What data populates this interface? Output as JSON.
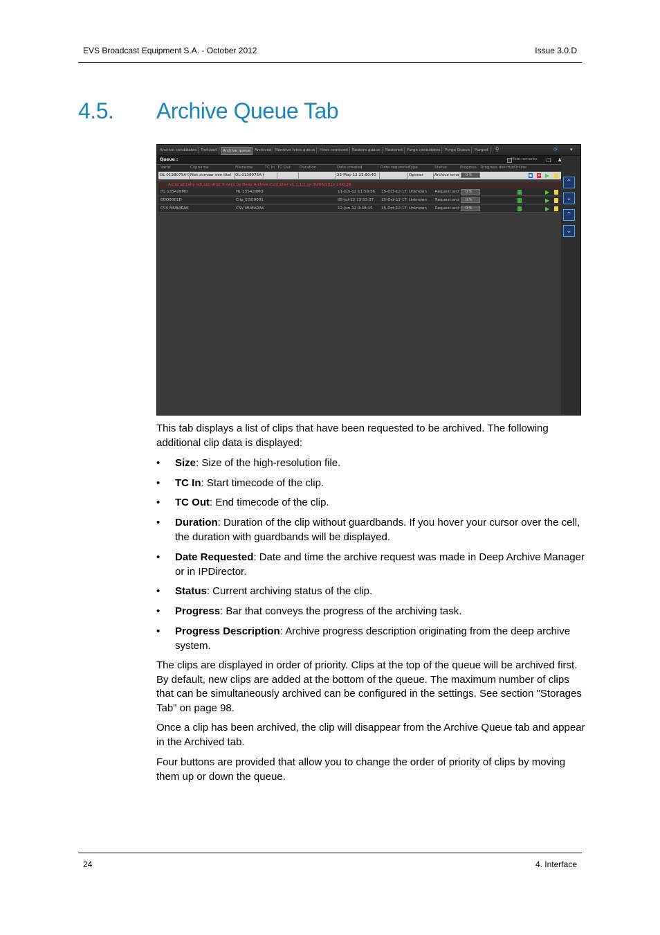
{
  "header": {
    "left": "EVS Broadcast Equipment S.A.  - October 2012",
    "right": "Issue 3.0.D"
  },
  "footer": {
    "left": "24",
    "right": "4. Interface"
  },
  "section": {
    "number": "4.5.",
    "title": "Archive Queue Tab"
  },
  "screenshot": {
    "tabs": [
      "Archive candidates",
      "Refused",
      "Archive queue",
      "Archived",
      "Remove hires queue",
      "Hires removed",
      "Restore queue",
      "Restored",
      "Purge candidates",
      "Purge Queue",
      "Purged"
    ],
    "active_tab": "Archive queue",
    "queue_label": "Queue :",
    "hide_remarks": "Hide remarks",
    "columns": [
      "VarId",
      "Clipname",
      "Filename",
      "TC In",
      "TC Out",
      "Duration",
      "Date created",
      "Date requested",
      "Type",
      "Status",
      "Progress",
      "Progress descript",
      "Online"
    ],
    "rows": [
      {
        "varid": "OL 0138075A 0",
        "clipname": "Niet zomaar een titel",
        "filename": "OL 0138075A 0",
        "date_created": "25-May-12 23:50:40",
        "date_requested": "",
        "type": "Opener",
        "status": "Archive error",
        "progress": "0 %"
      },
      {
        "varid": "HL 135428MO",
        "clipname": "",
        "filename": "HL 135428MO",
        "date_created": "11-Jun-12 11:59:56",
        "date_requested": "15-Oct-12 17:",
        "type": "Unknown",
        "status": "Request arch",
        "progress": "0 %"
      },
      {
        "varid": "EGO0001D",
        "clipname": "",
        "filename": "Clip_EGO0001D",
        "date_created": "05-Jul-12 13:53:37",
        "date_requested": "15-Oct-12 17:",
        "type": "Unknown",
        "status": "Request arch",
        "progress": "0 %"
      },
      {
        "varid": "CSV MUBARAK",
        "clipname": "",
        "filename": "CSV MUBARAK",
        "date_created": "12-Jun-12 0:48:15",
        "date_requested": "15-Oct-12 17:",
        "type": "Unknown",
        "status": "Request arch",
        "progress": "0 %"
      }
    ],
    "remark": "Automatically refused after 5 days by Deep Archive Controller v1.1.1.1 on 30/05/2012 2:00:28",
    "icons": [
      "refresh-icon",
      "move-up-icon",
      "move-down-icon",
      "move-top-icon",
      "move-bottom-icon",
      "play-icon",
      "note-icon",
      "delete-icon",
      "online-icon"
    ]
  },
  "body": {
    "intro": "This tab displays a list of clips that have been requested to be archived. The following additional clip data is displayed:",
    "items": [
      {
        "term": "Size",
        "desc": ": Size of the high-resolution file."
      },
      {
        "term": "TC In",
        "desc": ": Start timecode of the clip."
      },
      {
        "term": "TC Out",
        "desc": ": End timecode of the clip."
      },
      {
        "term": "Duration",
        "desc": ": Duration of the clip without guardbands. If you hover your cursor over the cell, the duration with guardbands will be displayed."
      },
      {
        "term": "Date Requested",
        "desc": ": Date and time the archive request was made in Deep Archive Manager or in IPDirector."
      },
      {
        "term": "Status",
        "desc": ": Current archiving status of the clip."
      },
      {
        "term": "Progress",
        "desc": ": Bar that conveys the progress of the archiving task."
      },
      {
        "term": "Progress Description",
        "desc": ": Archive progress description originating from the deep archive system."
      }
    ],
    "para1": "The clips are displayed in order of priority. Clips at the top of the queue will be archived first. By default, new clips are added at the bottom of the queue. The maximum number of clips that can be simultaneously archived can be configured in the settings. See section \"Storages Tab\" on page 98.",
    "para2": "Once a clip has been archived, the clip will disappear from the Archive Queue tab and appear in the Archived tab.",
    "para3": "Four buttons are provided that allow you to change the order of priority of clips by moving them up or down the queue."
  }
}
